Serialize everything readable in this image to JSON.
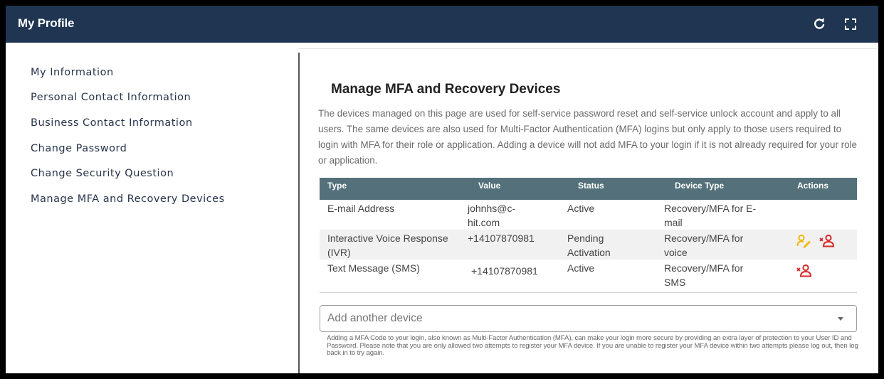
{
  "header": {
    "title": "My Profile",
    "refresh_icon": "refresh-icon",
    "fullscreen_icon": "fullscreen-icon"
  },
  "sidebar": {
    "items": [
      {
        "label": "My Information"
      },
      {
        "label": "Personal Contact Information"
      },
      {
        "label": "Business Contact Information"
      },
      {
        "label": "Change Password"
      },
      {
        "label": "Change Security Question"
      },
      {
        "label": "Manage MFA and Recovery Devices"
      }
    ]
  },
  "main": {
    "title": "Manage MFA and Recovery Devices",
    "description": "The devices managed on this page are used for self-service password reset and self-service unlock account and apply to all users. The same devices are also used for Multi-Factor Authentication (MFA) logins but only apply to those users required to login with MFA for their role or application. Adding a device will not add MFA to your login if it is not already required for your role or application.",
    "table": {
      "headers": [
        "Type",
        "Value",
        "Status",
        "Device Type",
        "Actions"
      ],
      "rows": [
        {
          "type": "E-mail Address",
          "value": "johnhs@c-hit.com",
          "status": "Active",
          "device_type": "Recovery/MFA for E-mail",
          "actions": []
        },
        {
          "type": "Interactive Voice Response (IVR)",
          "value": "+14107870981",
          "status": "Pending Activation",
          "device_type": "Recovery/MFA for voice",
          "actions": [
            "edit-user-icon",
            "remove-user-icon"
          ]
        },
        {
          "type": "Text Message (SMS)",
          "value": "+14107870981",
          "status": "Active",
          "device_type": "Recovery/MFA for SMS",
          "actions": [
            "remove-user-icon"
          ]
        }
      ]
    },
    "add_device": {
      "placeholder": "Add another device"
    },
    "note": "Adding a MFA Code to your login, also known as Multi-Factor Authentication (MFA), can make your login more secure by providing an extra layer of protection to your User ID and Password. Please note that you are only allowed two attempts to register your MFA device. If you are unable to register your MFA device within two attempts please log out, then log back in to try again."
  },
  "colors": {
    "header_bg": "#1f3552",
    "table_header_bg": "#54707a",
    "edit_icon": "#f2b705",
    "remove_icon": "#d62828"
  }
}
